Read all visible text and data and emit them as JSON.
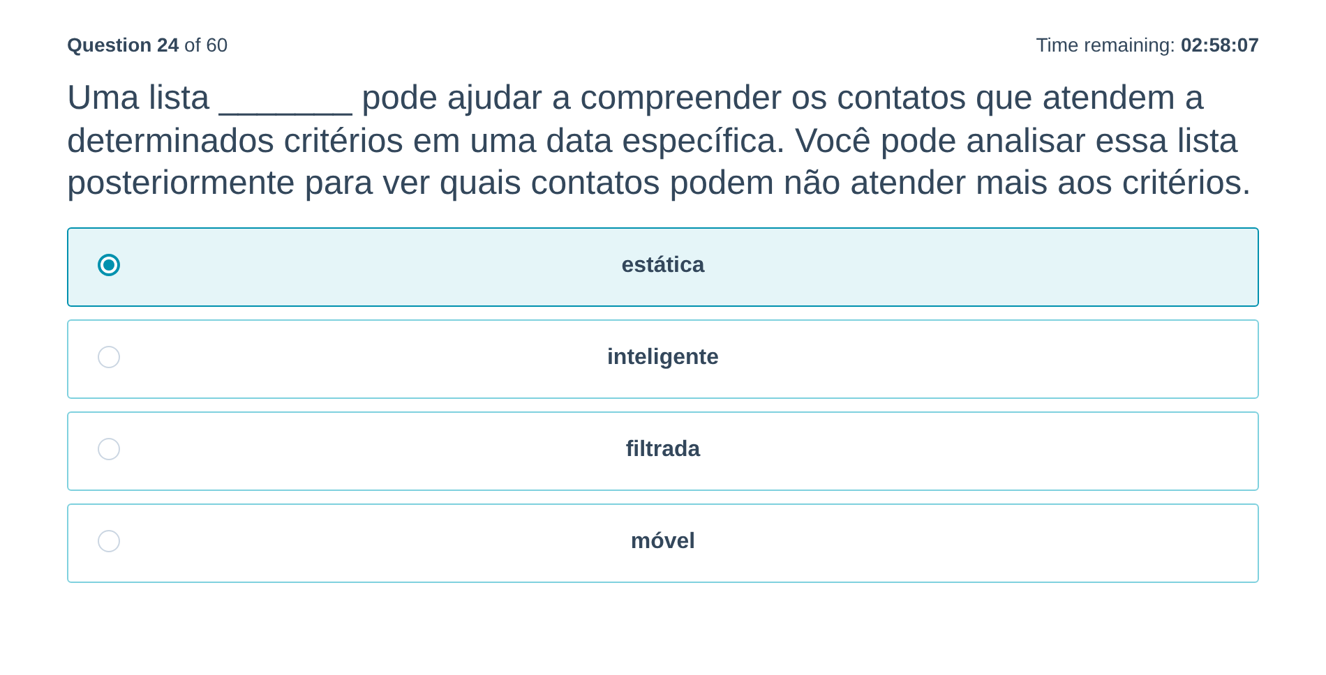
{
  "header": {
    "question_label": "Question",
    "question_number": "24",
    "of_text": "of 60",
    "time_label": "Time remaining:",
    "time_value": "02:58:07"
  },
  "question": "Uma lista _______ pode ajudar a compreender os contatos que atendem a determinados critérios em uma data específica. Você pode analisar essa lista posteriormente para ver quais contatos podem não atender mais aos critérios.",
  "options": [
    {
      "label": "estática",
      "selected": true
    },
    {
      "label": "inteligente",
      "selected": false
    },
    {
      "label": "filtrada",
      "selected": false
    },
    {
      "label": "móvel",
      "selected": false
    }
  ]
}
